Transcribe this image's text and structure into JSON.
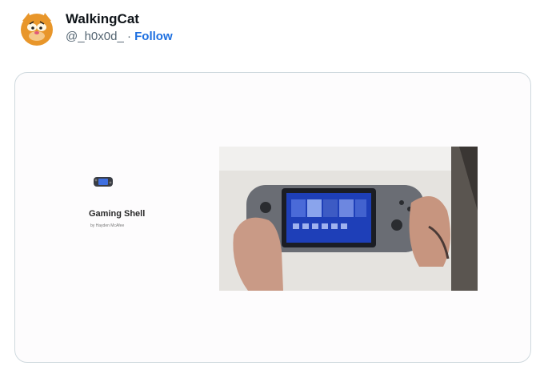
{
  "tweet": {
    "display_name": "WalkingCat",
    "handle": "@_h0x0d_",
    "separator": "·",
    "follow_label": "Follow"
  },
  "card": {
    "title": "Gaming Shell",
    "byline": "by Hayden McAfee"
  },
  "colors": {
    "follow": "#1d6fe0",
    "card_border": "#cfd9de",
    "handle_text": "#536471"
  }
}
